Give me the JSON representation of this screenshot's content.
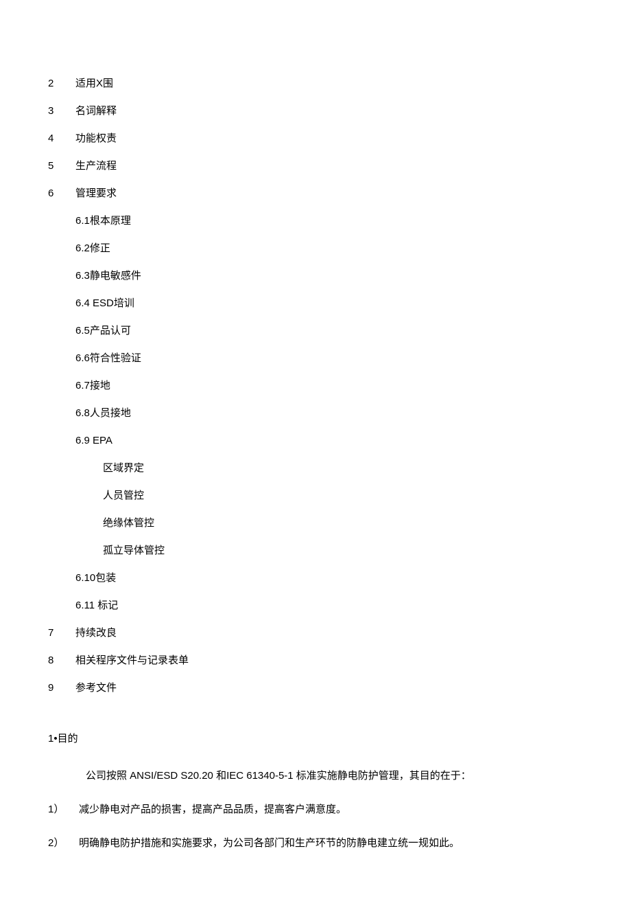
{
  "toc": {
    "items": [
      {
        "num": "2",
        "text": "适用X围"
      },
      {
        "num": "3",
        "text": "名词解释"
      },
      {
        "num": "4",
        "text": "功能权责"
      },
      {
        "num": "5",
        "text": "生产流程"
      },
      {
        "num": "6",
        "text": "管理要求"
      }
    ],
    "sub6": [
      {
        "text": "6.1根本原理"
      },
      {
        "text": "6.2修正"
      },
      {
        "text": "6.3静电敏感件"
      },
      {
        "text": "6.4 ESD培训"
      },
      {
        "text": "6.5产品认可"
      },
      {
        "text": "6.6符合性验证"
      },
      {
        "text": "6.7接地"
      },
      {
        "text": "6.8人员接地"
      },
      {
        "text": "6.9 EPA"
      }
    ],
    "sub69": [
      {
        "text": "区域界定"
      },
      {
        "text": "人员管控"
      },
      {
        "text": "绝缘体管控"
      },
      {
        "text": "孤立导体管控"
      }
    ],
    "sub6tail": [
      {
        "text": "6.10包装"
      },
      {
        "text": "6.11 标记"
      }
    ],
    "itemstail": [
      {
        "num": "7",
        "text": "持续改良"
      },
      {
        "num": "8",
        "text": "相关程序文件与记录表单"
      },
      {
        "num": "9",
        "text": "参考文件"
      }
    ]
  },
  "body": {
    "heading": "1•目的",
    "intro": "公司按照 ANSI/ESD S20.20 和IEC 61340-5-1 标准实施静电防护管理，其目的在于：",
    "points": [
      {
        "num": "1）",
        "text": "减少静电对产品的损害，提高产品品质，提高客户满意度。"
      },
      {
        "num": "2）",
        "text": "明确静电防护措施和实施要求，为公司各部门和生产环节的防静电建立统一规如此。"
      }
    ]
  }
}
